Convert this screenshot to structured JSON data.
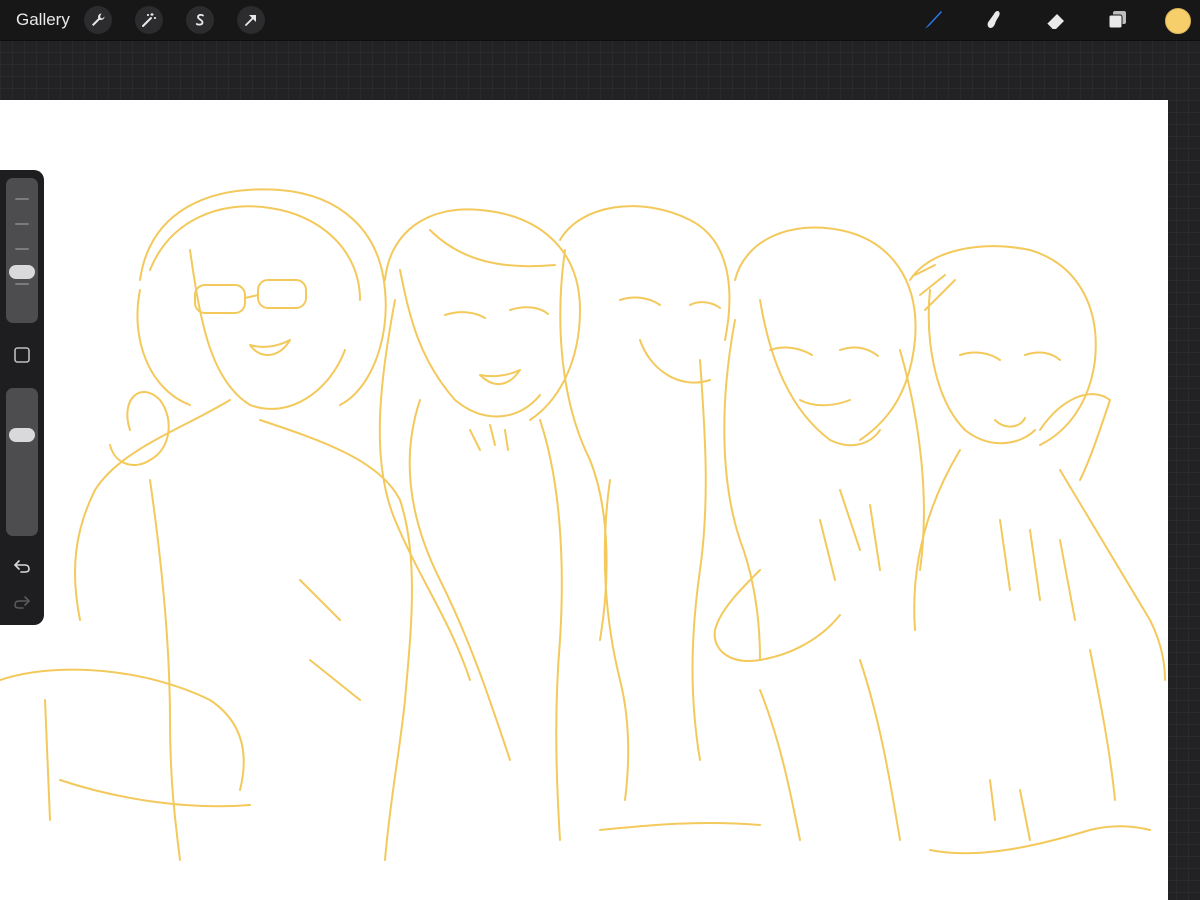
{
  "topbar": {
    "gallery_label": "Gallery",
    "left_tools": [
      {
        "name": "actions-wrench-icon"
      },
      {
        "name": "adjustments-magic-wand-icon"
      },
      {
        "name": "selection-s-icon"
      },
      {
        "name": "transform-arrow-icon"
      }
    ],
    "right_tools": [
      {
        "name": "brush-icon",
        "active": true
      },
      {
        "name": "smudge-icon"
      },
      {
        "name": "eraser-icon"
      },
      {
        "name": "layers-icon"
      }
    ],
    "current_color": "#f6cf6b",
    "active_tool_color": "#2f7bf5"
  },
  "sidebar": {
    "brush_size_slider": {
      "name": "brush-size-slider"
    },
    "modify_button": {
      "name": "modify-square-icon"
    },
    "opacity_slider": {
      "name": "brush-opacity-slider"
    },
    "undo": {
      "name": "undo-icon"
    },
    "redo": {
      "name": "redo-icon",
      "enabled": false
    }
  },
  "canvas": {
    "stroke_color": "#f3c95c",
    "content": "sketch"
  }
}
